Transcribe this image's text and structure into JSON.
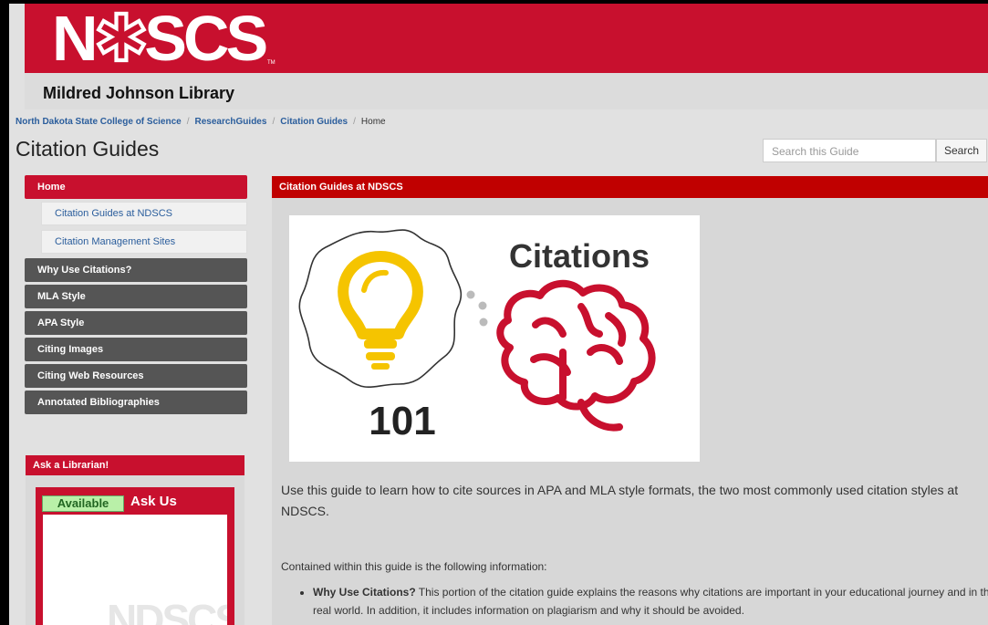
{
  "header": {
    "logo_text": "NDSCS",
    "logo_tm": "TM",
    "library_name": "Mildred Johnson Library"
  },
  "breadcrumb": {
    "items": [
      "North Dakota State College of Science",
      "ResearchGuides",
      "Citation Guides"
    ],
    "current": "Home",
    "separator": "/"
  },
  "page": {
    "title": "Citation Guides"
  },
  "search": {
    "placeholder": "Search this Guide",
    "button": "Search"
  },
  "nav": {
    "home": "Home",
    "sub_items": [
      "Citation Guides at NDSCS",
      "Citation Management Sites"
    ],
    "items": [
      "Why Use Citations?",
      "MLA Style",
      "APA Style",
      "Citing Images",
      "Citing Web Resources",
      "Annotated Bibliographies"
    ]
  },
  "ask": {
    "header": "Ask a Librarian!",
    "status": "Available",
    "ask_us": "Ask Us",
    "watermark": "NDSCS"
  },
  "content": {
    "header": "Citation Guides at NDSCS",
    "image_title": "Citations",
    "image_number": "101",
    "intro": "Use this guide to learn how to cite sources in APA and MLA style formats, the two most commonly used citation styles at NDSCS.",
    "contained": "Contained within this guide is the following information:",
    "bullets": [
      {
        "bold": "Why Use Citations?",
        "text": " This portion of the citation guide explains the reasons why citations are important in your educational journey and in the real world. In addition, it includes information on plagiarism and why it should be avoided."
      }
    ]
  },
  "colors": {
    "brand_red": "#c8102e",
    "nav_gray": "#555555",
    "link_blue": "#2a5d9c"
  }
}
